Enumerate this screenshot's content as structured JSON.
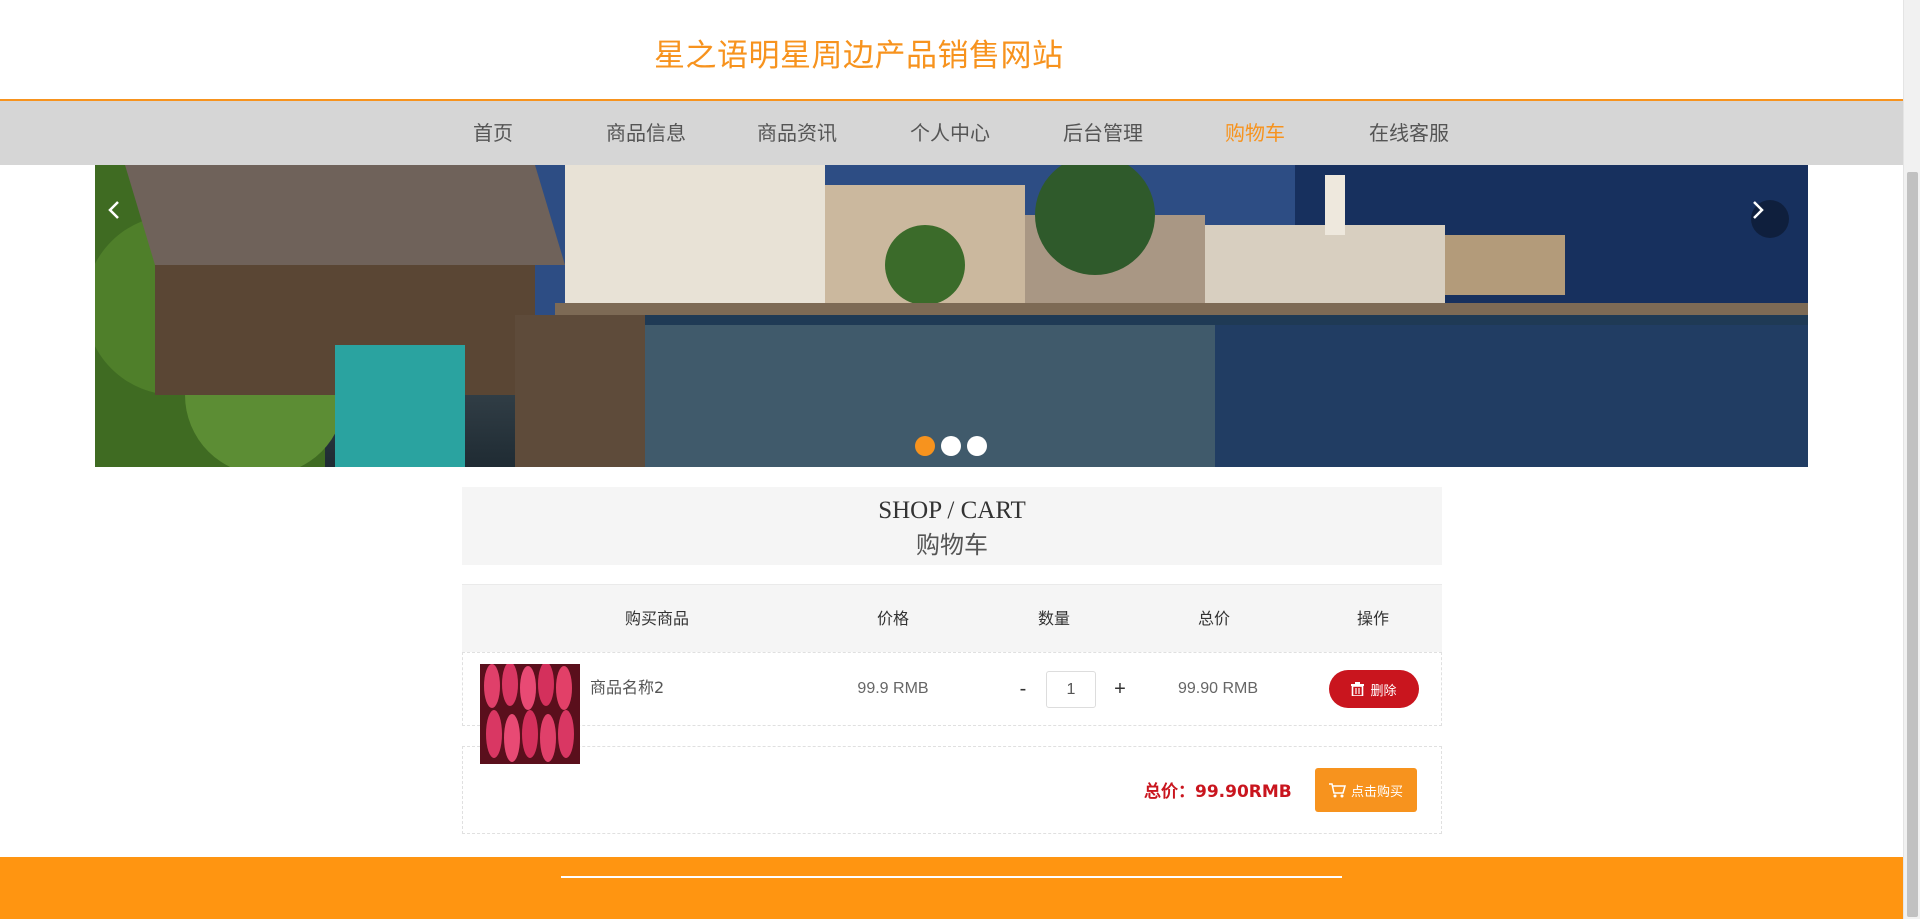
{
  "site": {
    "title": "星之语明星周边产品销售网站"
  },
  "nav": {
    "items": [
      {
        "label": "首页",
        "active": false
      },
      {
        "label": "商品信息",
        "active": false
      },
      {
        "label": "商品资讯",
        "active": false
      },
      {
        "label": "个人中心",
        "active": false
      },
      {
        "label": "后台管理",
        "active": false
      },
      {
        "label": "购物车",
        "active": true
      },
      {
        "label": "在线客服",
        "active": false
      }
    ],
    "active_color": "#f7931e"
  },
  "carousel": {
    "prev_icon": "chevron-left-icon",
    "next_icon": "chevron-right-icon",
    "slide_count": 3,
    "active_index": 0
  },
  "cart": {
    "heading_en": "SHOP / CART",
    "heading_zh": "购物车",
    "columns": [
      "购买商品",
      "价格",
      "数量",
      "总价",
      "操作"
    ],
    "items": [
      {
        "name": "商品名称2",
        "price": "99.9 RMB",
        "quantity": "1",
        "minus": "-",
        "plus": "+",
        "subtotal": "99.90 RMB",
        "delete_label": "删除",
        "delete_icon": "trash-icon"
      }
    ],
    "total_text": "总价：99.90RMB",
    "buy_label": "点击购买",
    "buy_icon": "cart-icon"
  },
  "colors": {
    "brand": "#f7931e",
    "danger": "#c9151e",
    "footer": "#ff9511"
  }
}
